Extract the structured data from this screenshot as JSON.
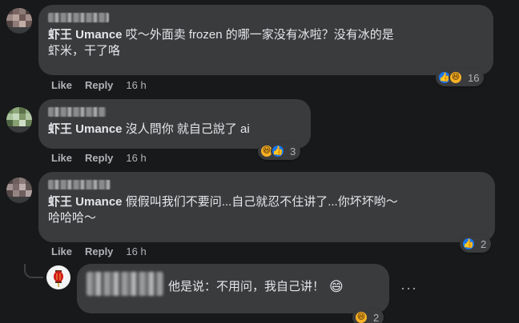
{
  "comments": [
    {
      "mention": "虾王 Umance",
      "text": " 哎～外面卖 frozen 的哪一家没有冰啦？没有冰的是",
      "text_line2": "虾米，干了咯",
      "like_label": "Like",
      "reply_label": "Reply",
      "time": "16 h",
      "reaction_count": "16"
    },
    {
      "mention": "虾王 Umance",
      "text": " 沒人問你 就自己說了 ai",
      "like_label": "Like",
      "reply_label": "Reply",
      "time": "16 h",
      "reaction_count": "3"
    },
    {
      "mention": "虾王 Umance",
      "text": " 假假叫我们不要问...自己就忍不住讲了...你坏坏哟～",
      "text_line2": "哈哈哈～",
      "like_label": "Like",
      "reply_label": "Reply",
      "time": "16 h",
      "reaction_count": "2"
    }
  ],
  "reply": {
    "text": "他是说：不用问，我自己讲！",
    "emoji": "😄",
    "reaction_count": "2",
    "more_label": "···"
  },
  "colors": {
    "background": "#18191a",
    "bubble": "#3a3b3c",
    "text": "#e4e6eb",
    "secondary": "#b0b3b8",
    "like_blue": "#1877f2",
    "haha_yellow": "#f7b125"
  },
  "icons": [
    "like-icon",
    "haha-icon",
    "more-icon"
  ]
}
